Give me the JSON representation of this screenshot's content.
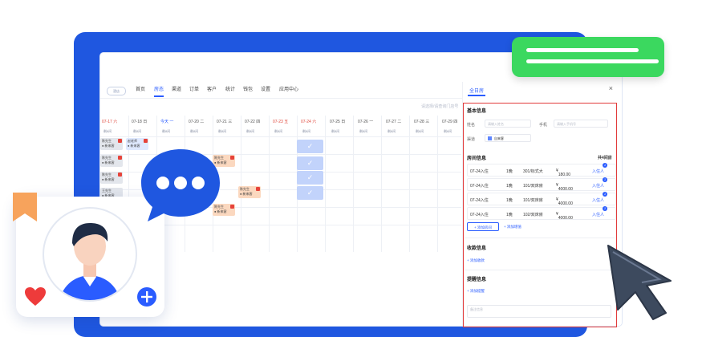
{
  "nav": {
    "logo": "酒店",
    "items": [
      "首页",
      "房态",
      "渠道",
      "订单",
      "客户",
      "统计",
      "钱包",
      "设置",
      "应用中心"
    ],
    "active_index": 1
  },
  "hint": "请选择/请查询门店号",
  "dates": [
    {
      "date": "07-17",
      "day": "六",
      "color": "red"
    },
    {
      "date": "07-18",
      "day": "日",
      "color": "normal"
    },
    {
      "date": "今天",
      "day": "一",
      "color": "blue"
    },
    {
      "date": "07-20",
      "day": "二",
      "color": "normal"
    },
    {
      "date": "07-21",
      "day": "三",
      "color": "normal"
    },
    {
      "date": "07-22",
      "day": "四",
      "color": "normal"
    },
    {
      "date": "07-23",
      "day": "五",
      "color": "red"
    },
    {
      "date": "07-24",
      "day": "六",
      "color": "red"
    },
    {
      "date": "07-25",
      "day": "日",
      "color": "normal"
    },
    {
      "date": "07-26",
      "day": "一",
      "color": "normal"
    },
    {
      "date": "07-27",
      "day": "二",
      "color": "normal"
    },
    {
      "date": "07-28",
      "day": "三",
      "color": "normal"
    },
    {
      "date": "07-29",
      "day": "四",
      "color": "normal"
    }
  ],
  "date_sub": [
    "剩8间",
    "剩8间",
    "剩8间",
    "剩8间",
    "剩8间",
    "剩8间",
    "剩8间",
    "剩8间",
    "剩8间",
    "剩8间",
    "剩8间",
    "剩8间",
    "剩8间"
  ],
  "bookings": [
    {
      "text": "陈先生",
      "sub": "● 新来客"
    },
    {
      "text": "赵老师",
      "sub": "● 新来客"
    },
    {
      "text": "陈先生",
      "sub": "● 新来客"
    },
    {
      "text": "陈先生",
      "sub": "● 新来客"
    },
    {
      "text": "王先生",
      "sub": "● 新来客"
    },
    {
      "text": "陈先生",
      "sub": "● 新来客"
    },
    {
      "text": "陈先生",
      "sub": "● 新来客"
    },
    {
      "text": "陈先生",
      "sub": "● 新来客"
    }
  ],
  "checks": [
    "✓",
    "✓",
    "✓",
    "✓"
  ],
  "panel": {
    "title": "全日房",
    "close": "×",
    "basic_title": "基本信息",
    "name_label": "姓名",
    "name_placeholder": "请输入姓名",
    "phone_label": "手机",
    "phone_placeholder": "请输入手机号",
    "channel_label": "渠道",
    "channel_value": "自来客",
    "room_title": "房间信息",
    "room_count": "共4间房",
    "rooms": [
      {
        "date": "07-24入住",
        "nights": "1晚",
        "room": "301/标式大",
        "price": "180.00",
        "status": "入住人",
        "badge": "1"
      },
      {
        "date": "07-24入住",
        "nights": "1晚",
        "room": "101/双床房",
        "price": "4000.00",
        "status": "入住人",
        "badge": "1"
      },
      {
        "date": "07-24入住",
        "nights": "1晚",
        "room": "101/双床房",
        "price": "4000.00",
        "status": "入住人",
        "badge": "1"
      },
      {
        "date": "07-24入住",
        "nights": "1晚",
        "room": "102/双床房",
        "price": "4000.00",
        "status": "入住人",
        "badge": "1"
      }
    ],
    "add_room": "+ 添加房间",
    "add_package": "+ 添加增值",
    "payment_title": "收款信息",
    "add_payment": "+ 添加收款",
    "remind_title": "提醒信息",
    "add_remind": "+ 添加提醒",
    "remark_placeholder": "备注信息"
  },
  "icons": {
    "chat": "chat-bubble-icon",
    "avatar": "user-avatar-icon",
    "heart": "heart-icon",
    "add": "plus-circle-icon",
    "bookmark": "bookmark-icon",
    "cursor": "cursor-arrow-icon"
  },
  "colors": {
    "brand": "#2a5cff",
    "frame": "#1f57e0",
    "green": "#3bd85f",
    "alert": "#e23b3b",
    "orange": "#f7a35c"
  }
}
